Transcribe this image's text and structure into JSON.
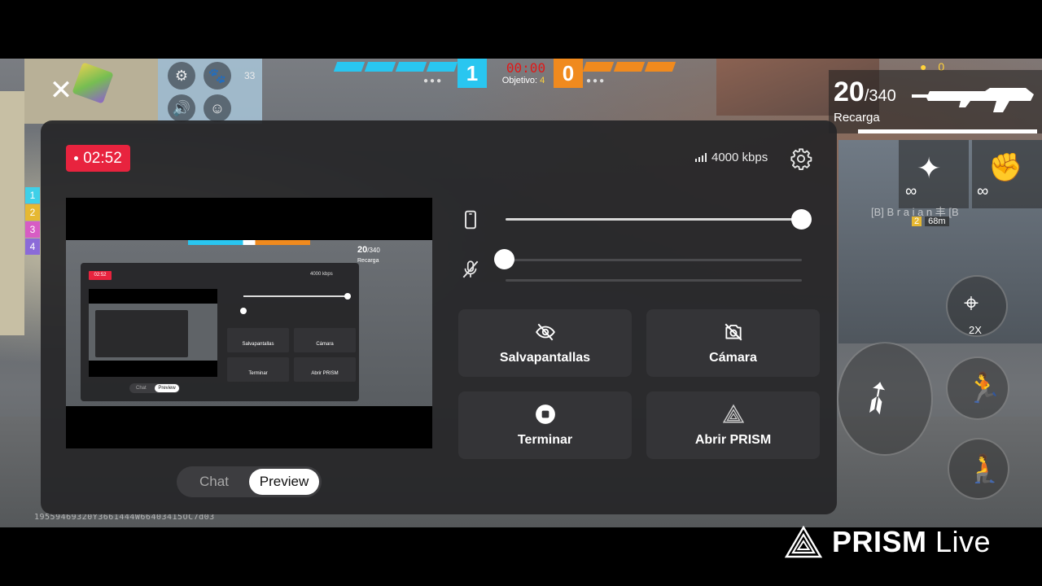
{
  "game": {
    "score_blue": "1",
    "score_orange": "0",
    "match_timer": "00:00",
    "objective_label": "Objetivo:",
    "objective_value": "4",
    "ammo_current": "20",
    "ammo_total": "/340",
    "reload_label": "Recarga",
    "coins": "0",
    "infinite_1": "∞",
    "infinite_2": "∞",
    "player_tag": "[B] B r a i a n 丰 [B",
    "player_rank": "2",
    "distance": "68m",
    "scope_label": "2X",
    "ping": "33",
    "team_slots": [
      "1",
      "2",
      "3",
      "4"
    ],
    "device_hash": "19559469320Y3661444W66403415OC7d03"
  },
  "overlay": {
    "close_icon": "close-icon",
    "rec_time": "02:52",
    "bitrate": "4000 kbps",
    "volume_device_level": 1.0,
    "volume_mic_level": 0.0,
    "buttons": {
      "screensaver": "Salvapantallas",
      "camera": "Cámara",
      "stop": "Terminar",
      "open_prism": "Abrir PRISM"
    },
    "tabs": {
      "chat": "Chat",
      "preview": "Preview"
    },
    "preview": {
      "rec_time": "02:52",
      "bitrate": "4000 kbps",
      "ammo_current": "20",
      "ammo_total": "/340",
      "reload_label": "Recarga",
      "buttons": [
        "Salvapantallas",
        "Cámara",
        "Terminar",
        "Abrir PRISM"
      ],
      "tabs": [
        "Chat",
        "Preview"
      ]
    }
  },
  "watermark": {
    "brand_bold": "PRISM",
    "brand_light": "Live"
  },
  "colors": {
    "rec_red": "#e8233e",
    "team_blue": "#29c6f0",
    "team_orange": "#f08a1e",
    "panel_bg": "#262628"
  }
}
